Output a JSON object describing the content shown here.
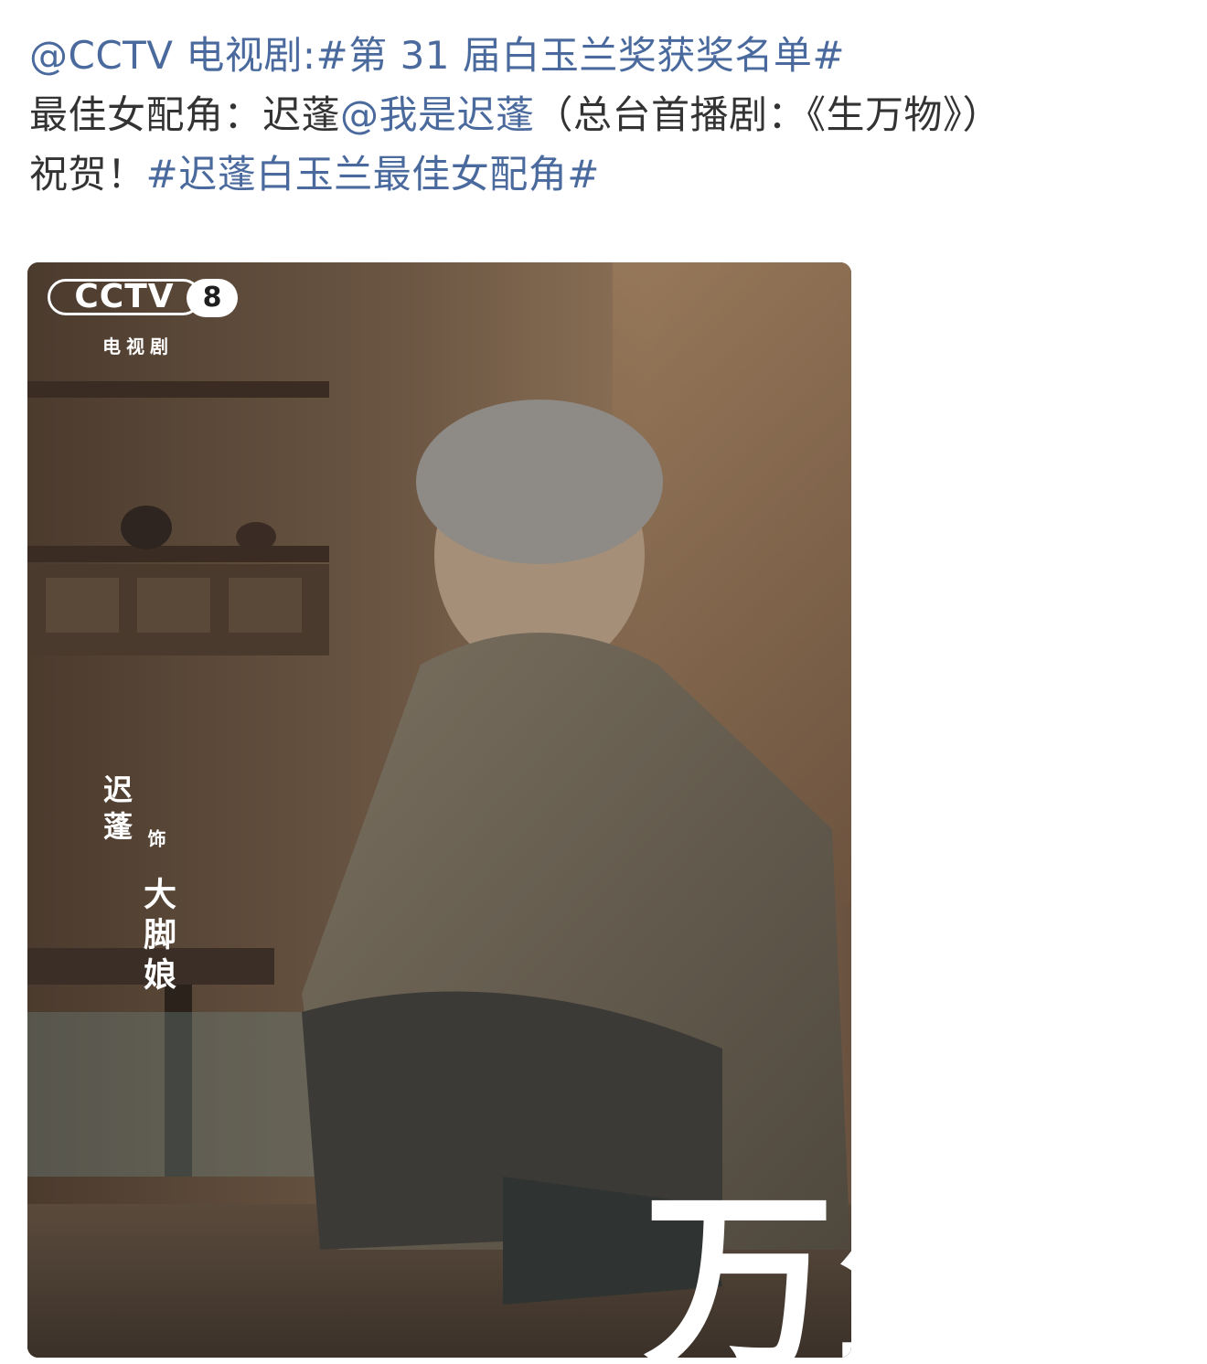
{
  "post": {
    "mention": "@CCTV 电视剧",
    "colon": ":",
    "hashtag1": "#第 31 届白玉兰奖获奖名单#",
    "award_label": "最佳女配角：迟蓬",
    "mention2": "@我是迟蓬",
    "paren_note": "（总台首播剧：《生万物》）",
    "congrats": "祝贺！",
    "hashtag2": "#迟蓬白玉兰最佳女配角#"
  },
  "poster": {
    "logo_mark": "CCTV",
    "logo_number": "8",
    "logo_sub": "电视剧",
    "actor": "迟蓬",
    "as": "饰",
    "role": "大脚娘",
    "title_glyphs": "生万"
  },
  "colors": {
    "link": "#4a6a9e",
    "text": "#333333"
  }
}
